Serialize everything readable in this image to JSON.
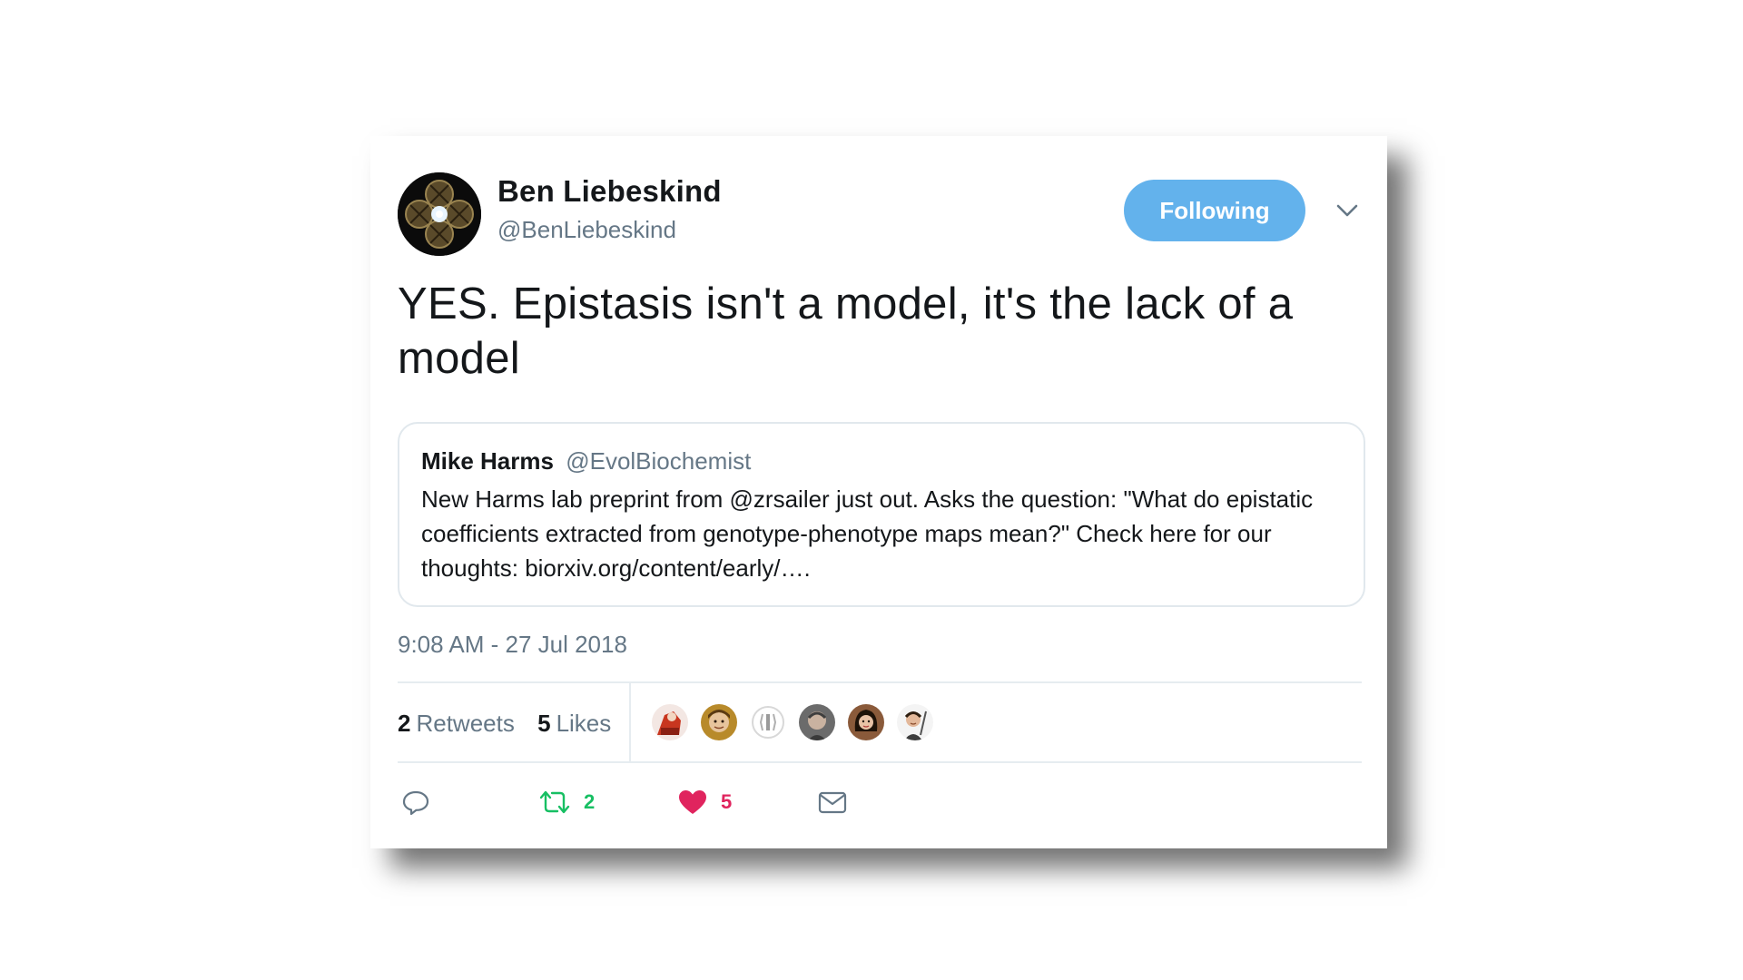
{
  "author": {
    "name": "Ben Liebeskind",
    "handle": "@BenLiebeskind",
    "avatar_icon": "avatar-icon"
  },
  "follow_button": {
    "label": "Following",
    "color": "#63b2ec"
  },
  "menu_icon": "chevron-down-icon",
  "tweet": {
    "text": "YES. Epistasis isn't a model, it's the lack of a model",
    "timestamp": "9:08 AM - 27 Jul 2018"
  },
  "quoted_tweet": {
    "name": "Mike Harms",
    "handle": "@EvolBiochemist",
    "text": "New Harms lab preprint from @zrsailer just out.  Asks the question: \"What do epistatic coefficients extracted from genotype-phenotype maps mean?\" Check here for our thoughts: biorxiv.org/content/early/…."
  },
  "stats": {
    "retweets_count": "2",
    "retweets_label": "Retweets",
    "likes_count": "5",
    "likes_label": "Likes"
  },
  "liker_avatars": [
    "avatar-icon",
    "avatar-icon",
    "avatar-icon",
    "avatar-icon",
    "avatar-icon",
    "avatar-icon"
  ],
  "actions": {
    "reply_icon": "reply-icon",
    "retweet_icon": "retweet-icon",
    "retweet_count": "2",
    "like_icon": "heart-icon",
    "like_count": "5",
    "dm_icon": "envelope-icon"
  },
  "colors": {
    "text": "#14171a",
    "muted": "#657786",
    "retweet": "#17bf63",
    "like": "#e0245e",
    "border": "#e1e8ed"
  }
}
